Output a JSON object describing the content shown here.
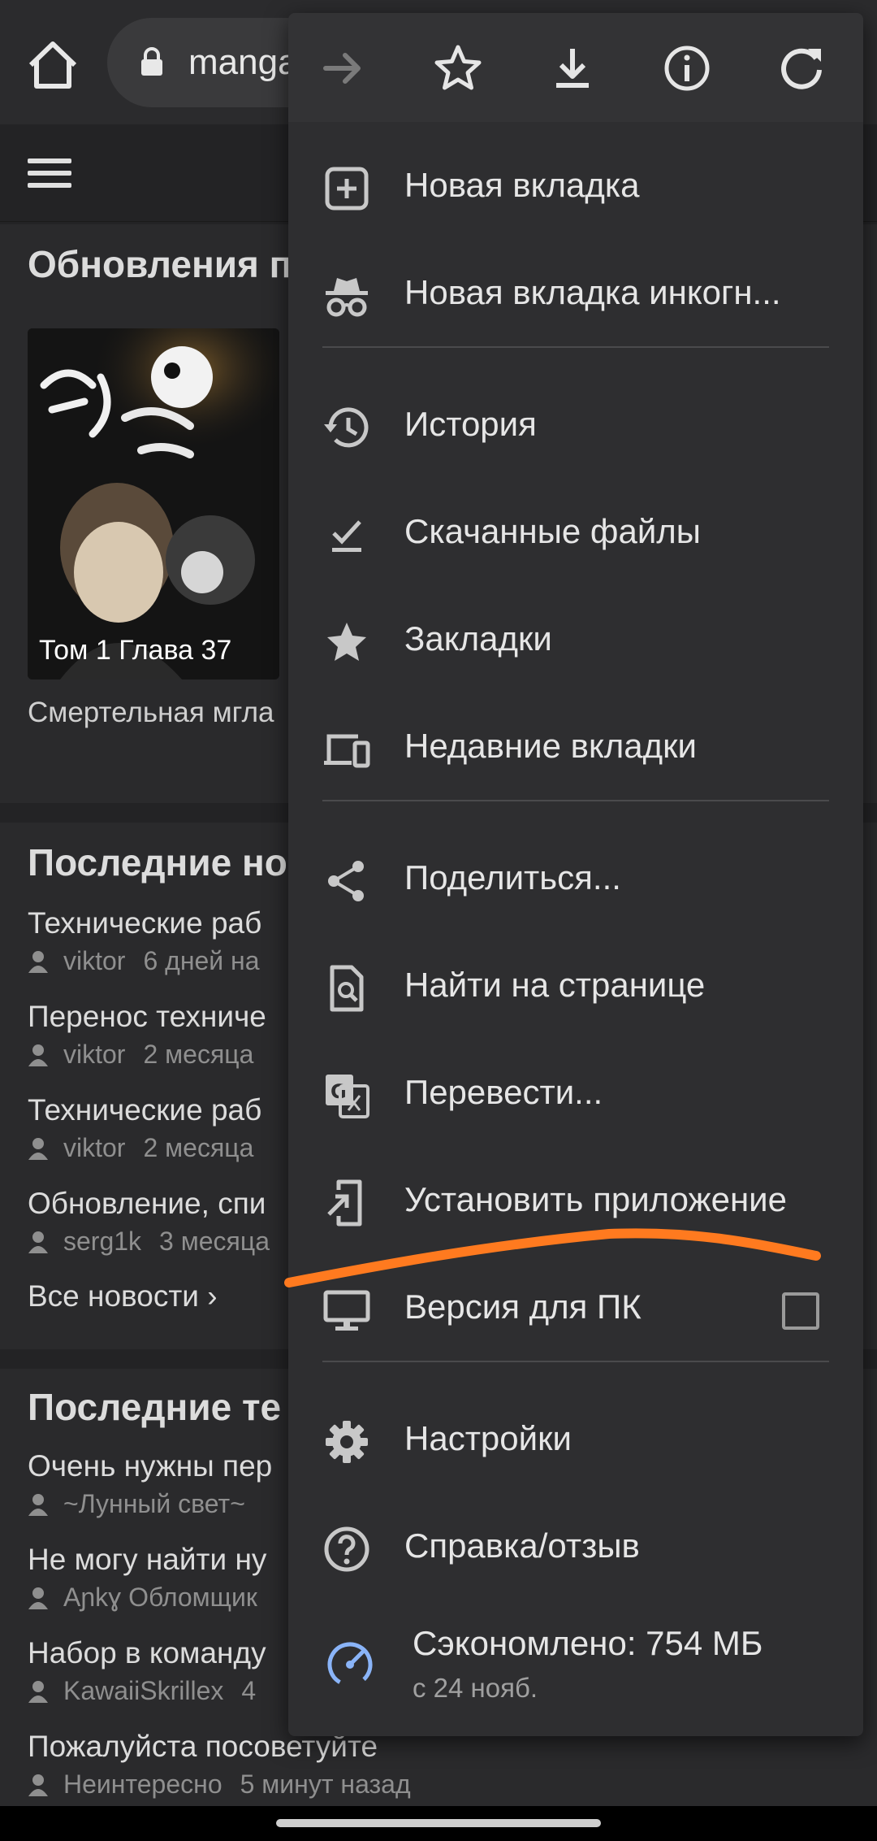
{
  "browser": {
    "url_text": "manga"
  },
  "page": {
    "updates_title": "Обновления п",
    "cover_caption": "Том 1 Глава 37",
    "manga_title": "Смертельная мгла",
    "news_title": "Последние но",
    "news": [
      {
        "title": "Технические раб",
        "user": "viktor",
        "time": "6 дней на"
      },
      {
        "title": "Перенос техниче",
        "user": "viktor",
        "time": "2 месяца"
      },
      {
        "title": "Технические раб",
        "user": "viktor",
        "time": "2 месяца"
      },
      {
        "title": "Обновление, спи",
        "user": "serg1k",
        "time": "3 месяца"
      }
    ],
    "all_news": "Все новости  ›",
    "topics_title": "Последние те",
    "topics": [
      {
        "title": "Очень нужны пер",
        "user": "~Лунный свет~",
        "time": ""
      },
      {
        "title": "Не могу найти ну",
        "user": "Aɲkɣ Обломщик",
        "time": ""
      },
      {
        "title": "Набор в команду",
        "user": "KawaiiSkrillex",
        "time": "4"
      },
      {
        "title": "Пожалуйста посоветуйте",
        "user": "Неинтересно",
        "time": "5 минут назад"
      }
    ]
  },
  "menu": {
    "items": [
      {
        "label": "Новая вкладка",
        "icon": "new-tab-icon"
      },
      {
        "label": "Новая вкладка инкогн...",
        "icon": "incognito-icon"
      },
      {
        "label": "История",
        "icon": "history-icon"
      },
      {
        "label": "Скачанные файлы",
        "icon": "downloads-icon"
      },
      {
        "label": "Закладки",
        "icon": "star-icon"
      },
      {
        "label": "Недавние вкладки",
        "icon": "devices-icon"
      },
      {
        "label": "Поделиться...",
        "icon": "share-icon"
      },
      {
        "label": "Найти на странице",
        "icon": "find-in-page-icon"
      },
      {
        "label": "Перевести...",
        "icon": "translate-icon"
      },
      {
        "label": "Установить приложение",
        "icon": "install-app-icon"
      },
      {
        "label": "Версия для ПК",
        "icon": "desktop-icon",
        "checked": false
      },
      {
        "label": "Настройки",
        "icon": "settings-icon"
      },
      {
        "label": "Справка/отзыв",
        "icon": "help-icon"
      }
    ],
    "saved_label": "Сэкономлено: 754 МБ",
    "saved_sub": "с 24 нояб."
  },
  "colors": {
    "menu_bg": "#2e2e30",
    "annotation": "#ff7a1f",
    "data_saver": "#8ab4f8"
  }
}
